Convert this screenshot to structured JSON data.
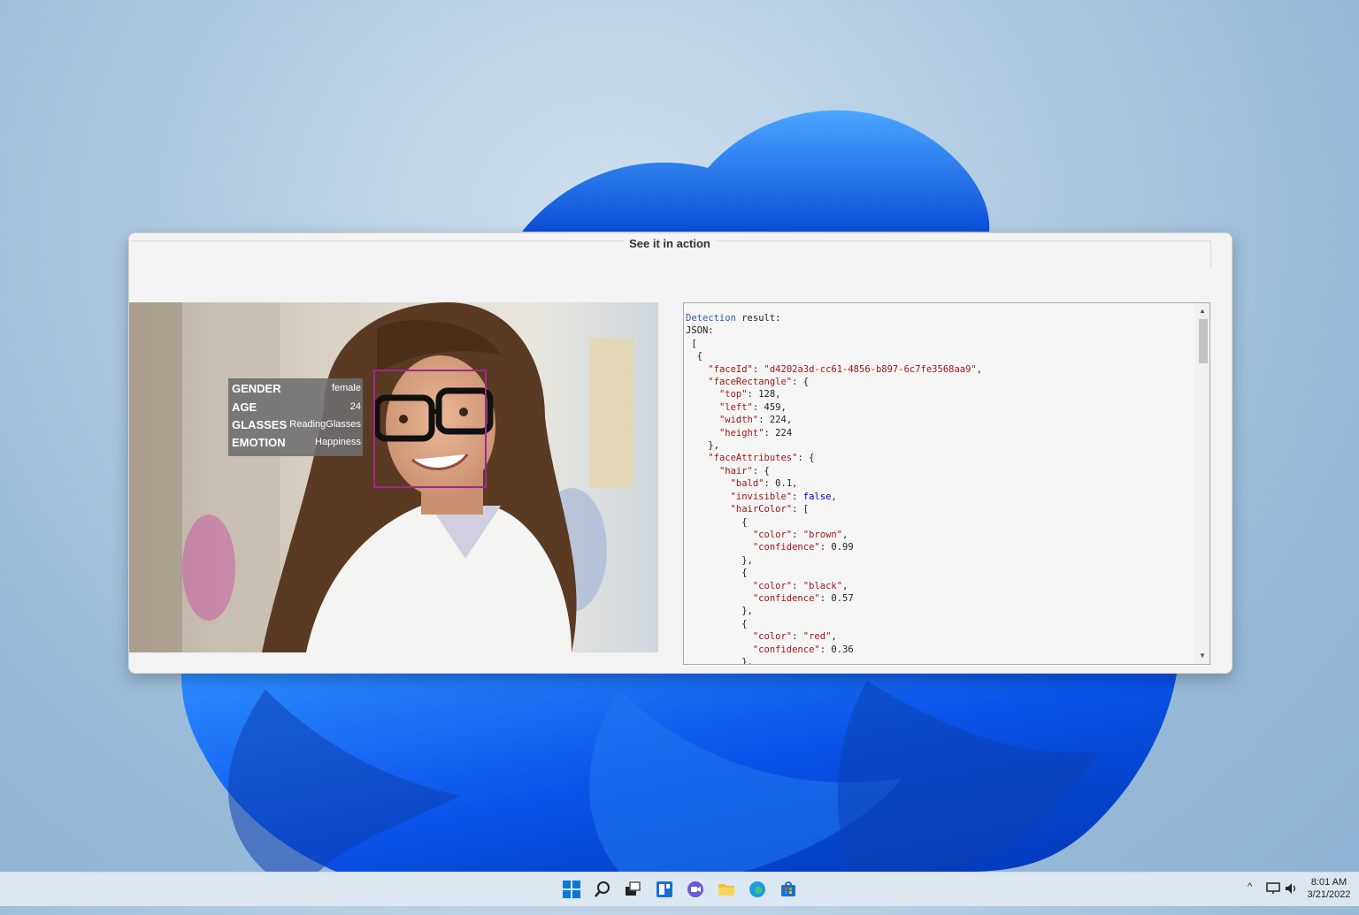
{
  "window": {
    "title": "See it in action"
  },
  "attributes": [
    {
      "key": "GENDER",
      "value": "female"
    },
    {
      "key": "AGE",
      "value": "24"
    },
    {
      "key": "GLASSES",
      "value": "ReadingGlasses"
    },
    {
      "key": "EMOTION",
      "value": "Happiness"
    }
  ],
  "json_output": {
    "header_word": "Detection",
    "header_rest": " result:",
    "label": "JSON:",
    "faceId": "\"d4202a3d-cc61-4856-b897-6c7fe3568aa9\"",
    "top": "128",
    "left": "459",
    "width": "224",
    "height": "224",
    "bald": "0.1",
    "invisible": "false",
    "colors": [
      {
        "color": "\"brown\"",
        "confidence": "0.99"
      },
      {
        "color": "\"black\"",
        "confidence": "0.57"
      },
      {
        "color": "\"red\"",
        "confidence": "0.36"
      }
    ]
  },
  "tray": {
    "time": "8:01 AM",
    "date": "3/21/2022"
  },
  "colors": {
    "face_rect": "#a0268f",
    "taskbar": "#e2eaf3"
  }
}
